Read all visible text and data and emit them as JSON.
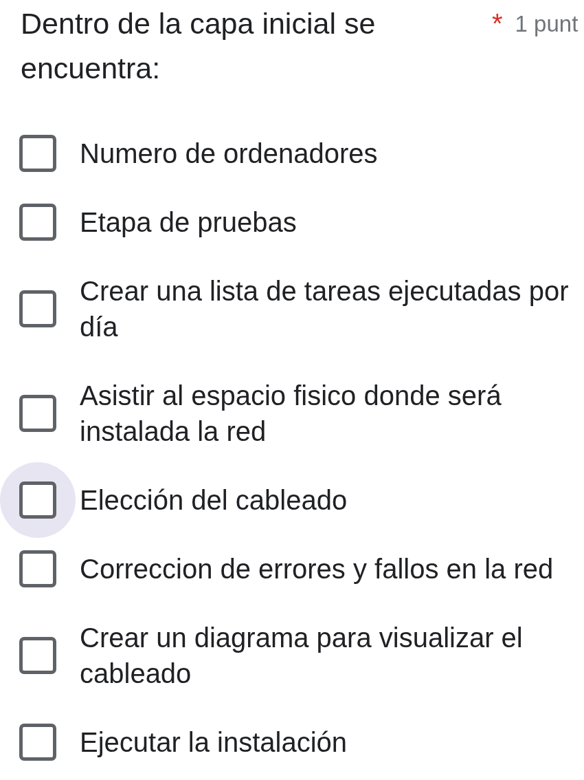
{
  "question": {
    "title": "Dentro de la capa inicial se encuentra:",
    "required_mark": "*",
    "points": "1 punt"
  },
  "options": [
    {
      "label": "Numero de ordenadores",
      "checked": false,
      "hovered": false
    },
    {
      "label": "Etapa de pruebas",
      "checked": false,
      "hovered": false
    },
    {
      "label": "Crear una lista de tareas ejecutadas por día",
      "checked": false,
      "hovered": false
    },
    {
      "label": "Asistir al espacio fisico donde será instalada la red",
      "checked": false,
      "hovered": false
    },
    {
      "label": "Elección del cableado",
      "checked": false,
      "hovered": true
    },
    {
      "label": "Correccion de errores y fallos en la red",
      "checked": false,
      "hovered": false
    },
    {
      "label": "Crear un diagrama para visualizar el cableado",
      "checked": false,
      "hovered": false
    },
    {
      "label": "Ejecutar la instalación",
      "checked": false,
      "hovered": false
    }
  ]
}
